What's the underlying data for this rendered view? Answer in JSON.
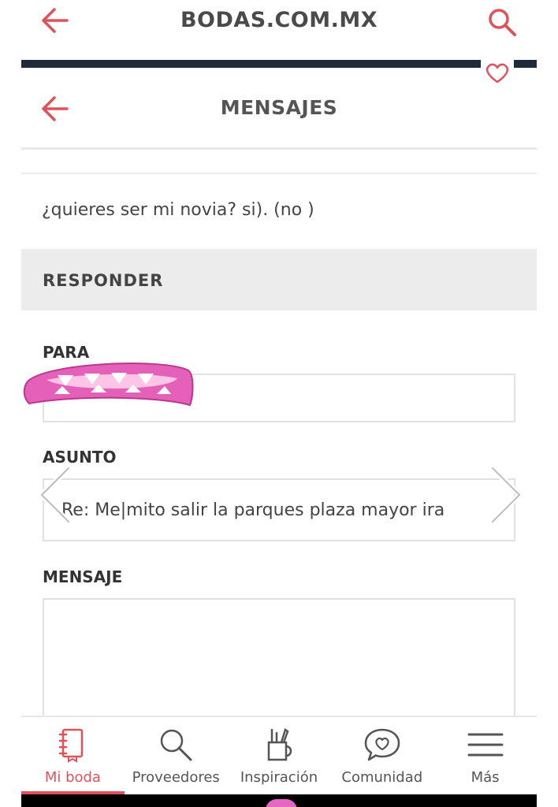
{
  "colors": {
    "accent": "#e0525b",
    "text": "#444444",
    "band": "#ececec",
    "sticker": "#e560b8"
  },
  "topbar": {
    "title": "BODAS.COM.MX",
    "back_icon": "back-arrow-icon",
    "search_icon": "search-icon"
  },
  "inner_header": {
    "title": "MENSAJES",
    "back_icon": "back-arrow-icon",
    "favorite_icon": "heart-icon"
  },
  "message": {
    "text": "¿quieres ser mi novia? si). (no )"
  },
  "reply": {
    "section_label": "RESPONDER",
    "para_label": "PARA",
    "para_value": "",
    "asunto_label": "ASUNTO",
    "asunto_value": "Re: Me|mito salir la parques  plaza mayor ira",
    "mensaje_label": "MENSAJE",
    "mensaje_value": ""
  },
  "bottom_nav": {
    "items": [
      {
        "label": "Mi boda",
        "icon": "notebook-icon",
        "active": true
      },
      {
        "label": "Proveedores",
        "icon": "search-icon",
        "active": false
      },
      {
        "label": "Inspiración",
        "icon": "crafts-cup-icon",
        "active": false
      },
      {
        "label": "Comunidad",
        "icon": "chat-heart-icon",
        "active": false
      },
      {
        "label": "Más",
        "icon": "menu-icon",
        "active": false
      }
    ]
  }
}
